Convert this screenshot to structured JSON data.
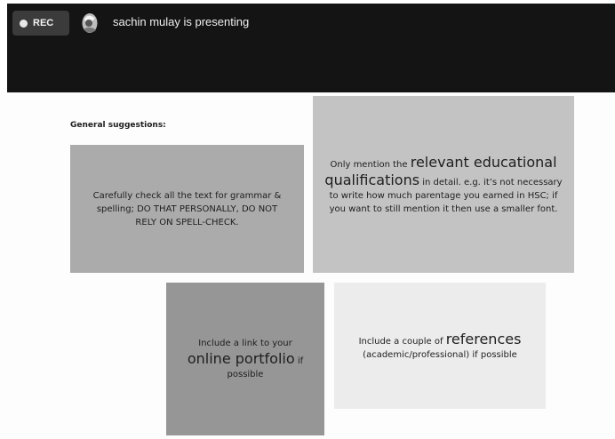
{
  "meeting": {
    "rec_label": "REC",
    "presenter_text": "sachin mulay is presenting"
  },
  "slide": {
    "heading": "General suggestions:",
    "cards": [
      {
        "text": "Carefully check all the text for grammar & spelling; DO THAT PERSONALLY, DO NOT RELY ON SPELL-CHECK."
      },
      {
        "pre": "Only mention the ",
        "emphasis": "relevant educational qualifications",
        "post": " in detail. e.g. it’s not necessary to write how much parentage you earned in HSC; if you want to still mention it then use a smaller font."
      },
      {
        "pre": "Include a link to your ",
        "emphasis": "online portfolio",
        "post": " if possible"
      },
      {
        "pre": "Include a couple of ",
        "emphasis": "references",
        "post": " (academic/professional) if possible"
      }
    ]
  },
  "colors": {
    "topbar": "#141414",
    "card_1": "#ababab",
    "card_2": "#c3c3c3",
    "card_3": "#969696",
    "card_4": "#ececec"
  },
  "icons": {
    "record": "record-dot-icon",
    "presenter": "presenter-avatar-icon"
  }
}
